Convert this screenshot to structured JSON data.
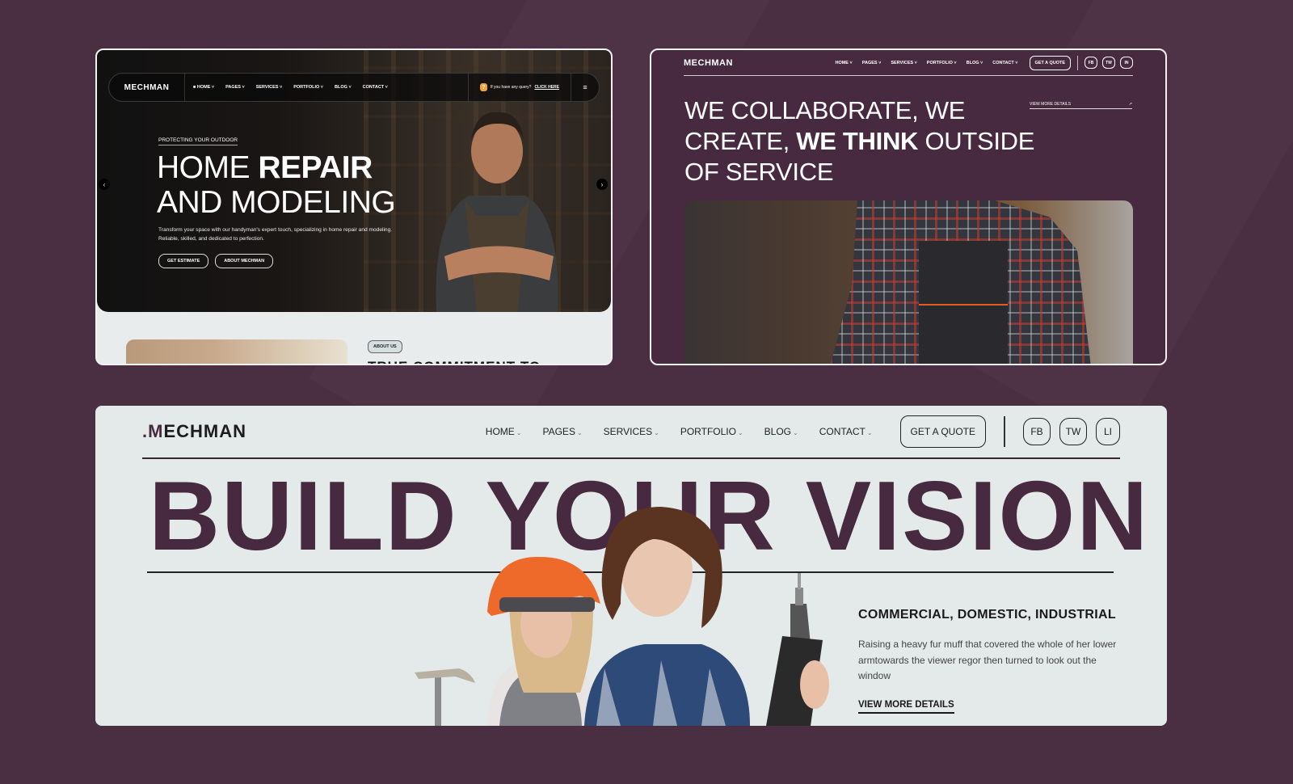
{
  "brand": {
    "name": "MECHMAN",
    "background_color": "#4a2f43",
    "accent_color": "#472a3f"
  },
  "card_dark_hero": {
    "nav": {
      "logo": "MECHMAN",
      "items": [
        {
          "label": "HOME",
          "active": true
        },
        {
          "label": "PAGES"
        },
        {
          "label": "SERVICES"
        },
        {
          "label": "PORTFOLIO"
        },
        {
          "label": "BLOG"
        },
        {
          "label": "CONTACT"
        }
      ],
      "query_text": "If you have any query?",
      "query_link": "CLICK HERE",
      "menu_icon": "hamburger-icon"
    },
    "eyebrow": "PROTECTING YOUR OUTDOOR",
    "title_light_1": "HOME ",
    "title_bold_1": "REPAIR",
    "title_line_2": "AND MODELING",
    "description": "Transform your space with our handyman's expert touch, specializing in home repair and modeling. Reliable, skilled, and dedicated to perfection.",
    "buttons": {
      "primary": "GET ESTIMATE",
      "secondary": "ABOUT MECHMAN"
    },
    "slider": {
      "prev_icon": "chevron-left-icon",
      "next_icon": "chevron-right-icon"
    },
    "about": {
      "badge": "ABOUT US",
      "title": "TRUE COMMITMENT TO"
    }
  },
  "card_purple": {
    "nav": {
      "logo": "MECHMAN",
      "items": [
        "HOME",
        "PAGES",
        "SERVICES",
        "PORTFOLIO",
        "BLOG",
        "CONTACT"
      ],
      "cta": "GET A QUOTE",
      "social": [
        "FB",
        "TW",
        "IN"
      ]
    },
    "title_1": "WE COLLABORATE, WE",
    "title_2a": "CREATE, ",
    "title_2b": "WE THINK",
    "title_2c": " OUTSIDE",
    "title_3": "OF SERVICE",
    "view_more": "VIEW MORE DETAILS",
    "view_more_icon": "arrow-up-right-icon"
  },
  "card_light": {
    "nav": {
      "logo_mark": ".M",
      "logo_rest": "ECHMAN",
      "items": [
        {
          "label": "HOME",
          "active": true
        },
        {
          "label": "PAGES"
        },
        {
          "label": "SERVICES"
        },
        {
          "label": "PORTFOLIO"
        },
        {
          "label": "BLOG"
        },
        {
          "label": "CONTACT"
        }
      ],
      "cta": "GET A QUOTE",
      "social": [
        "FB",
        "TW",
        "LI"
      ]
    },
    "headline": "BUILD YOUR VISION",
    "side_title": "COMMERCIAL, DOMESTIC, INDUSTRIAL",
    "side_desc": "Raising a heavy fur muff that covered the whole of her lower armtowards the viewer regor then turned to look out the window",
    "view_more": "VIEW MORE DETAILS"
  }
}
